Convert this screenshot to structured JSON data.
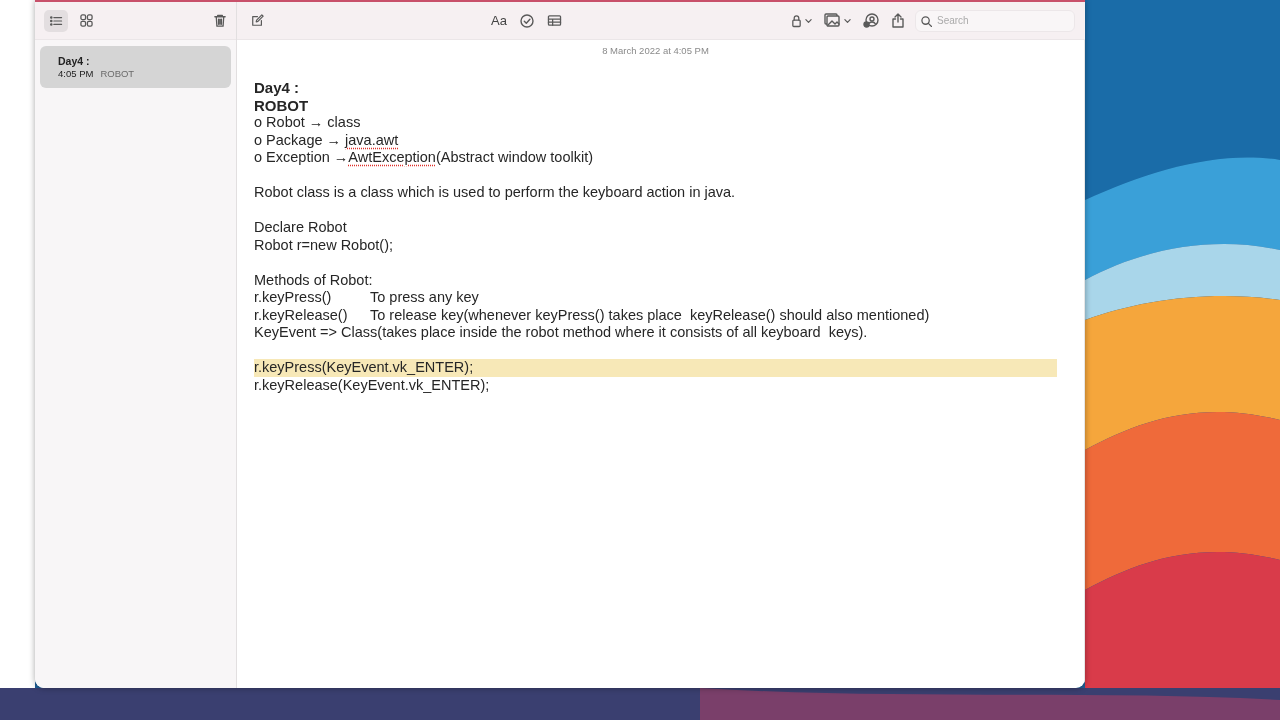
{
  "sidebar": {
    "view_buttons": [
      {
        "kind": "list",
        "selected": true
      },
      {
        "kind": "grid",
        "selected": false
      }
    ],
    "notes": [
      {
        "title": "Day4 :",
        "time": "4:05 PM",
        "preview": "ROBOT",
        "selected": true
      }
    ]
  },
  "toolbar": {
    "format_label": "Aa",
    "search": {
      "placeholder": "Search"
    }
  },
  "note": {
    "date": "8 March 2022 at 4:05 PM",
    "lines": [
      {
        "kind": "heading",
        "highlighted": false,
        "segments": [
          {
            "text": "Day4 :"
          }
        ]
      },
      {
        "kind": "heading",
        "highlighted": false,
        "segments": [
          {
            "text": "ROBOT"
          }
        ]
      },
      {
        "kind": "text",
        "highlighted": false,
        "segments": [
          {
            "text": "o Robot → class"
          }
        ]
      },
      {
        "kind": "text",
        "highlighted": false,
        "segments": [
          {
            "text": "o Package → "
          },
          {
            "text": "java.awt",
            "misspelled": true
          }
        ]
      },
      {
        "kind": "text",
        "highlighted": false,
        "segments": [
          {
            "text": "o Exception →"
          },
          {
            "text": "AwtException",
            "misspelled": true
          },
          {
            "text": "(Abstract window toolkit)"
          }
        ]
      },
      {
        "kind": "blank"
      },
      {
        "kind": "text",
        "highlighted": false,
        "segments": [
          {
            "text": "Robot class is a class which is used to perform the keyboard action in java."
          }
        ]
      },
      {
        "kind": "blank"
      },
      {
        "kind": "text",
        "highlighted": false,
        "segments": [
          {
            "text": "Declare Robot"
          }
        ]
      },
      {
        "kind": "text",
        "highlighted": false,
        "segments": [
          {
            "text": "Robot r=new Robot();"
          }
        ]
      },
      {
        "kind": "blank"
      },
      {
        "kind": "text",
        "highlighted": false,
        "segments": [
          {
            "text": "Methods of Robot:"
          }
        ]
      },
      {
        "kind": "method",
        "highlighted": false,
        "method": "r.keyPress()",
        "description": "To press any key"
      },
      {
        "kind": "method",
        "highlighted": false,
        "method": "r.keyRelease()",
        "description": "To release key(whenever keyPress() takes place  keyRelease() should also mentioned)"
      },
      {
        "kind": "text",
        "highlighted": false,
        "segments": [
          {
            "text": "KeyEvent => Class(takes place inside the robot method where it consists of all keyboard  keys)."
          }
        ]
      },
      {
        "kind": "blank"
      },
      {
        "kind": "text",
        "highlighted": true,
        "segments": [
          {
            "text": "r.keyPress(KeyEvent.vk_ENTER);"
          }
        ]
      },
      {
        "kind": "text",
        "highlighted": false,
        "segments": [
          {
            "text": "r.keyRelease(KeyEvent.vk_ENTER);"
          }
        ]
      }
    ]
  }
}
